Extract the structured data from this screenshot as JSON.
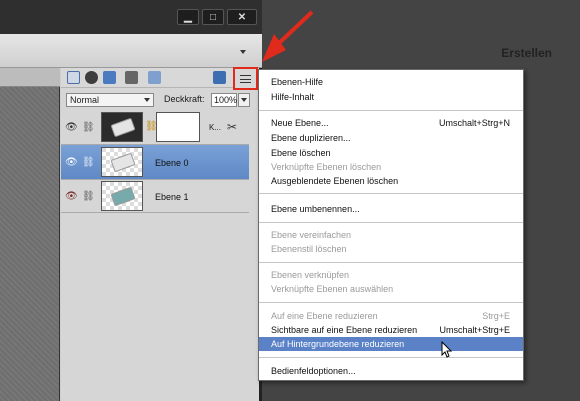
{
  "header": {
    "minimize_icon": "minimize-icon",
    "maximize_icon": "maximize-icon",
    "close_icon": "close-icon",
    "create_label": "Erstellen"
  },
  "layers_panel": {
    "blend_mode": "Normal",
    "opacity_label": "Deckkraft:",
    "opacity_value": "100%",
    "layers": [
      {
        "name": "K...",
        "visible": true
      },
      {
        "name": "Ebene 0",
        "visible": true,
        "selected": true
      },
      {
        "name": "Ebene 1",
        "visible": false
      }
    ]
  },
  "menu": {
    "items": [
      {
        "label": "Ebenen-Hilfe",
        "shortcut": "",
        "disabled": false
      },
      {
        "label": "Hilfe-Inhalt",
        "shortcut": "",
        "disabled": false
      },
      {
        "label": "Neue Ebene...",
        "shortcut": "Umschalt+Strg+N",
        "disabled": false
      },
      {
        "label": "Ebene duplizieren...",
        "shortcut": "",
        "disabled": false
      },
      {
        "label": "Ebene löschen",
        "shortcut": "",
        "disabled": false
      },
      {
        "label": "Verknüpfte Ebenen löschen",
        "shortcut": "",
        "disabled": true
      },
      {
        "label": "Ausgeblendete Ebenen löschen",
        "shortcut": "",
        "disabled": false
      },
      {
        "label": "Ebene umbenennen...",
        "shortcut": "",
        "disabled": false
      },
      {
        "label": "Ebene vereinfachen",
        "shortcut": "",
        "disabled": true
      },
      {
        "label": "Ebenenstil löschen",
        "shortcut": "",
        "disabled": true
      },
      {
        "label": "Ebenen verknüpfen",
        "shortcut": "",
        "disabled": true
      },
      {
        "label": "Verknüpfte Ebenen auswählen",
        "shortcut": "",
        "disabled": true
      },
      {
        "label": "Auf eine Ebene reduzieren",
        "shortcut": "Strg+E",
        "disabled": true
      },
      {
        "label": "Sichtbare auf eine Ebene reduzieren",
        "shortcut": "Umschalt+Strg+E",
        "disabled": false
      },
      {
        "label": "Auf Hintergrundebene reduzieren",
        "shortcut": "",
        "disabled": false,
        "highlighted": true
      },
      {
        "label": "Bedienfeldoptionen...",
        "shortcut": "",
        "disabled": false
      }
    ]
  },
  "colors": {
    "highlight": "#5b82c7",
    "selected_layer": "#6b93cf",
    "annotation_red": "#e02a1c"
  }
}
